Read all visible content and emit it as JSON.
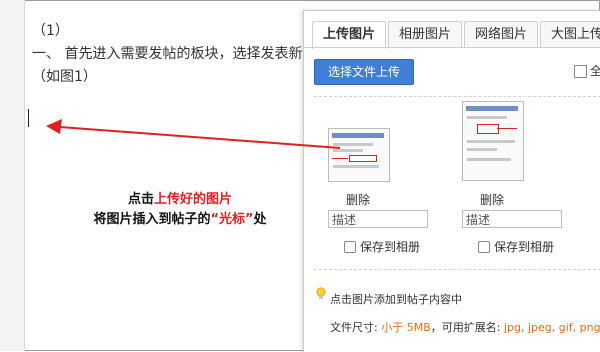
{
  "editor": {
    "line1": "（1）",
    "line2": "一、 首先进入需要发帖的板块，选择发表新",
    "line3": "（如图1）"
  },
  "annotation": {
    "line1_prefix": "点击",
    "line1_highlight": "上传好的图片",
    "line2_prefix": "将图片插入到帖子的",
    "line2_highlight": "“光标”",
    "line2_suffix": "处"
  },
  "panel": {
    "tabs": [
      {
        "label": "上传图片",
        "active": true
      },
      {
        "label": "相册图片",
        "active": false
      },
      {
        "label": "网络图片",
        "active": false
      },
      {
        "label": "大图上传",
        "active": false
      }
    ],
    "upload_button": "选择文件上传",
    "select_all_label": "全",
    "images": [
      {
        "delete_label": "删除",
        "desc_placeholder": "描述",
        "save_label": "保存到相册"
      },
      {
        "delete_label": "删除",
        "desc_placeholder": "描述",
        "save_label": "保存到相册"
      }
    ],
    "tip": "点击图片添加到帖子内容中",
    "file_size_label": "文件尺寸: ",
    "file_size_value": "小于 5MB",
    "ext_label": "，可用扩展名: ",
    "ext_value": "jpg, jpeg, gif, png"
  },
  "colors": {
    "accent_red": "#e02020",
    "button_blue": "#3f7fd6",
    "tip_orange": "#ef6b1a"
  }
}
